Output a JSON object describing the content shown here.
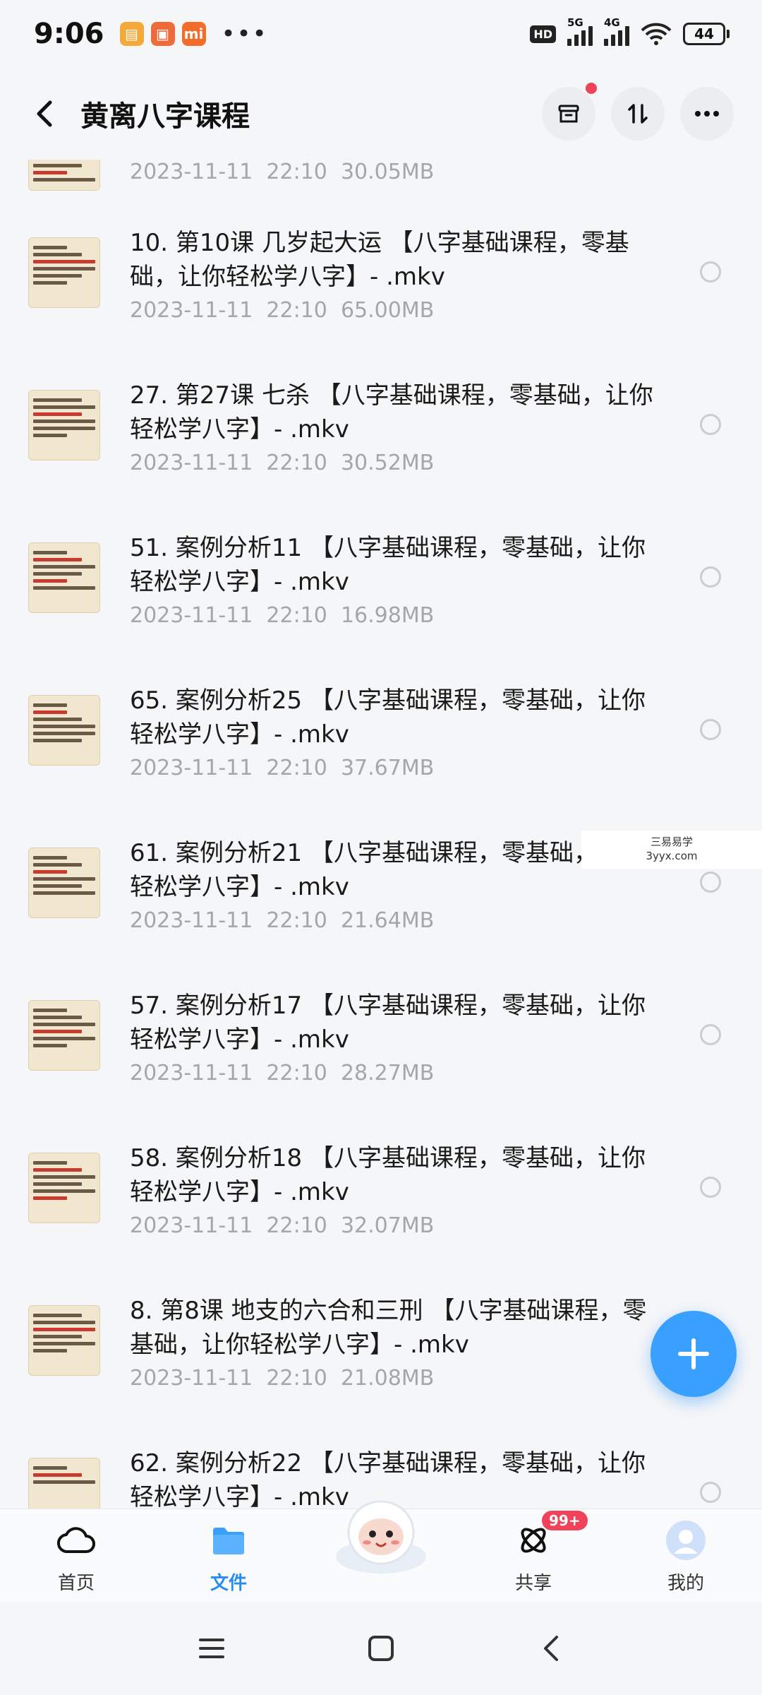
{
  "status_bar": {
    "time": "9:06",
    "more": "•••",
    "hd": "HD",
    "net1": "5G",
    "net2": "4G",
    "battery": "44",
    "app_icon_colors": [
      "#f4a93a",
      "#f06b3a",
      "#f26c2a"
    ]
  },
  "header": {
    "title": "黄离八字课程",
    "back_icon": "chevron-left-icon",
    "actions": [
      "archive-icon",
      "sort-icon",
      "more-icon"
    ]
  },
  "files": [
    {
      "name": "",
      "meta": "2023-11-11  22:10  30.05MB"
    },
    {
      "name": "10. 第10课 几岁起大运 【八字基础课程，零基础，让你轻松学八字】- .mkv",
      "meta": "2023-11-11  22:10  65.00MB"
    },
    {
      "name": "27. 第27课 七杀 【八字基础课程，零基础，让你轻松学八字】- .mkv",
      "meta": "2023-11-11  22:10  30.52MB"
    },
    {
      "name": "51. 案例分析11 【八字基础课程，零基础，让你轻松学八字】- .mkv",
      "meta": "2023-11-11  22:10  16.98MB"
    },
    {
      "name": "65. 案例分析25 【八字基础课程，零基础，让你轻松学八字】- .mkv",
      "meta": "2023-11-11  22:10  37.67MB"
    },
    {
      "name": "61. 案例分析21 【八字基础课程，零基础，让你轻松学八字】- .mkv",
      "meta": "2023-11-11  22:10  21.64MB"
    },
    {
      "name": "57. 案例分析17 【八字基础课程，零基础，让你轻松学八字】- .mkv",
      "meta": "2023-11-11  22:10  28.27MB"
    },
    {
      "name": "58. 案例分析18 【八字基础课程，零基础，让你轻松学八字】- .mkv",
      "meta": "2023-11-11  22:10  32.07MB"
    },
    {
      "name": "8. 第8课 地支的六合和三刑 【八字基础课程，零基础，让你轻松学八字】- .mkv",
      "meta": "2023-11-11  22:10  21.08MB"
    },
    {
      "name": "62. 案例分析22 【八字基础课程，零基础，让你轻松学八字】- .mkv",
      "meta": ""
    }
  ],
  "watermark": {
    "line1": "三易易学",
    "line2": "3yyx.com"
  },
  "fab": {
    "icon": "plus-icon"
  },
  "tabs": [
    {
      "label": "首页",
      "icon": "cloud-icon"
    },
    {
      "label": "文件",
      "icon": "folder-icon"
    },
    {
      "label": "",
      "icon": "mascot-icon"
    },
    {
      "label": "共享",
      "icon": "share-orbit-icon",
      "badge": "99+"
    },
    {
      "label": "我的",
      "icon": "avatar-icon"
    }
  ],
  "colors": {
    "accent": "#2b8cf0",
    "fab": "#3aa0ff",
    "badge": "#f0435a"
  }
}
